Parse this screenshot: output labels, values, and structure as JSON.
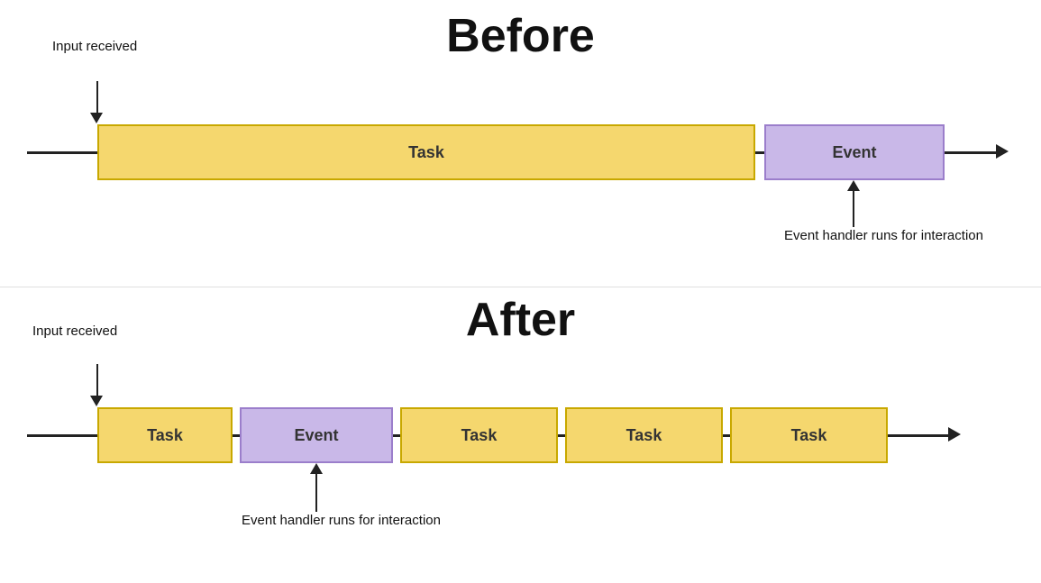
{
  "before": {
    "title": "Before",
    "input_label": "Input\nreceived",
    "task_label": "Task",
    "event_label": "Event",
    "event_handler_label": "Event handler\nruns for interaction"
  },
  "after": {
    "title": "After",
    "input_label": "Input\nreceived",
    "task_label": "Task",
    "event_label": "Event",
    "task2_label": "Task",
    "task3_label": "Task",
    "task4_label": "Task",
    "event_handler_label": "Event handler\nruns for interaction"
  }
}
